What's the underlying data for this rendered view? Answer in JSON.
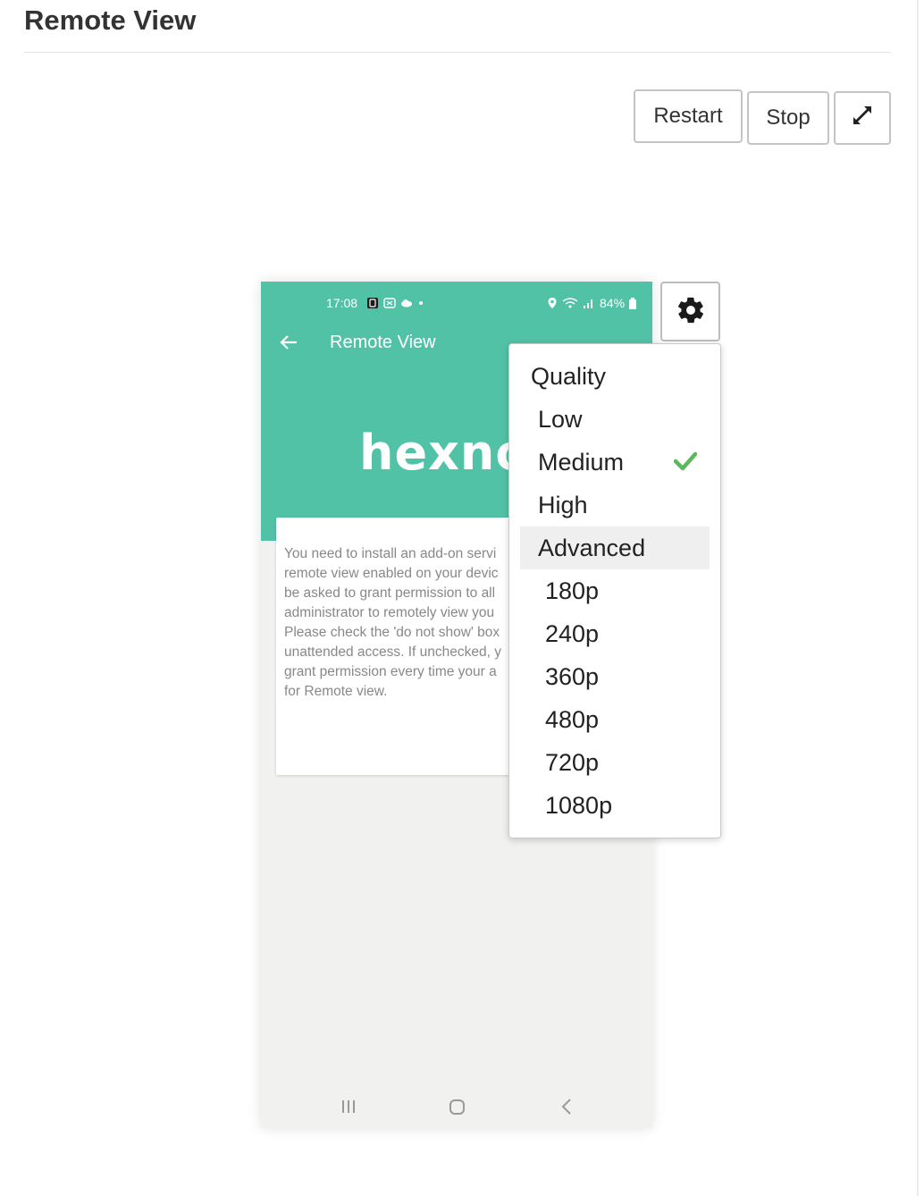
{
  "page": {
    "title": "Remote View"
  },
  "toolbar": {
    "restart_label": "Restart",
    "stop_label": "Stop",
    "fullscreen_icon": "expand-arrows-icon"
  },
  "device": {
    "status_bar": {
      "time": "17:08",
      "battery": "84%"
    },
    "app_bar": {
      "title": "Remote View"
    },
    "logo_text": "hexnoc",
    "card_text": "You need to install an add-on servi\nremote view enabled on your devic\nbe asked to grant permission to all\nadministrator to remotely view you\nPlease check the 'do not show' box\nunattended access. If unchecked, y\ngrant permission every time your a\nfor Remote view.",
    "colors": {
      "header": "#52c2a6",
      "background": "#f1f1ef"
    }
  },
  "settings": {
    "gear_icon": "gear-icon",
    "menu": {
      "quality_heading": "Quality",
      "quality_options": [
        "Low",
        "Medium",
        "High"
      ],
      "selected_quality": "Medium",
      "advanced_label": "Advanced",
      "resolutions": [
        "180p",
        "240p",
        "360p",
        "480p",
        "720p",
        "1080p"
      ],
      "check_color": "#5cb85c"
    }
  }
}
